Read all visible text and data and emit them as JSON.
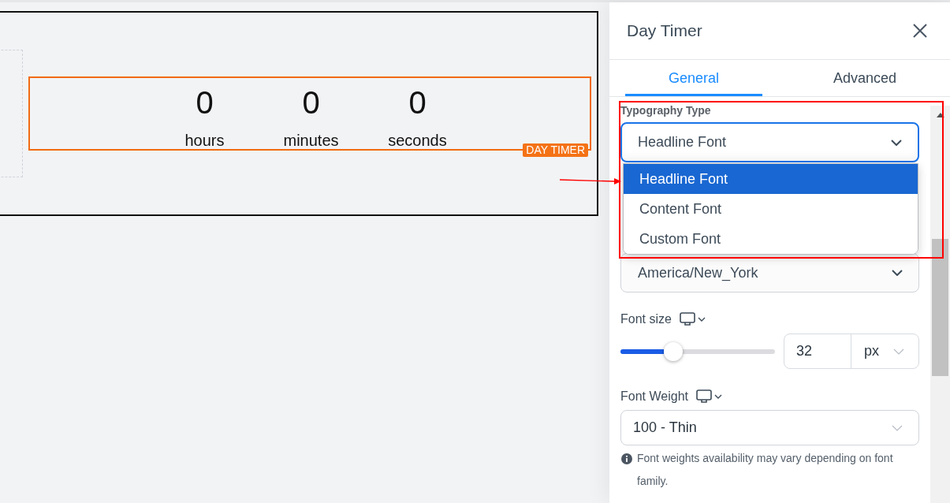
{
  "canvas": {
    "timer": {
      "units": [
        {
          "value": "0",
          "label": "hours"
        },
        {
          "value": "0",
          "label": "minutes"
        },
        {
          "value": "0",
          "label": "seconds"
        }
      ],
      "tag": "DAY TIMER"
    }
  },
  "panel": {
    "title": "Day Timer",
    "tabs": [
      {
        "label": "General",
        "selected": true
      },
      {
        "label": "Advanced",
        "selected": false
      }
    ],
    "typography_type": {
      "label": "Typography Type",
      "value": "Headline Font",
      "expanded": true,
      "options": [
        {
          "label": "Headline Font",
          "selected": true
        },
        {
          "label": "Content Font",
          "selected": false
        },
        {
          "label": "Custom Font",
          "selected": false
        }
      ]
    },
    "timezone": {
      "value": "America/New_York"
    },
    "font_size": {
      "label": "Font size",
      "level": 0.34,
      "value": "32",
      "unit": "px"
    },
    "font_weight": {
      "label": "Font Weight",
      "value": "100 - Thin",
      "note": "Font weights availability may vary depending on font family."
    }
  }
}
